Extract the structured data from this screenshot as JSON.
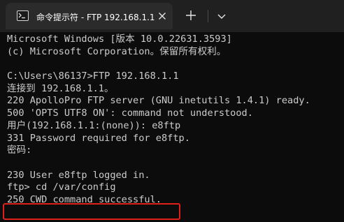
{
  "tab": {
    "title": "命令提示符 - FTP  192.168.1.1",
    "icon": "terminal-icon",
    "close_icon": "close-icon"
  },
  "toolbar": {
    "new_tab_icon": "plus-icon",
    "dropdown_icon": "chevron-down-icon"
  },
  "terminal": {
    "lines": [
      "Microsoft Windows [版本 10.0.22631.3593]",
      "(c) Microsoft Corporation。保留所有权利。",
      "",
      "C:\\Users\\86137>FTP 192.168.1.1",
      "连接到 192.168.1.1。",
      "220 ApolloPro FTP server (GNU inetutils 1.4.1) ready.",
      "500 'OPTS UTF8 ON': command not understood.",
      "用户(192.168.1.1:(none)): e8ftp",
      "331 Password required for e8ftp.",
      "密码:",
      "",
      "230 User e8ftp logged in.",
      "ftp> cd /var/config",
      "250 CWD command successful."
    ]
  },
  "colors": {
    "background": "#0c0c0c",
    "text": "#cccccc",
    "tabbar": "#202020",
    "active_tab": "#2b2b2b",
    "highlight": "#e0201a"
  }
}
